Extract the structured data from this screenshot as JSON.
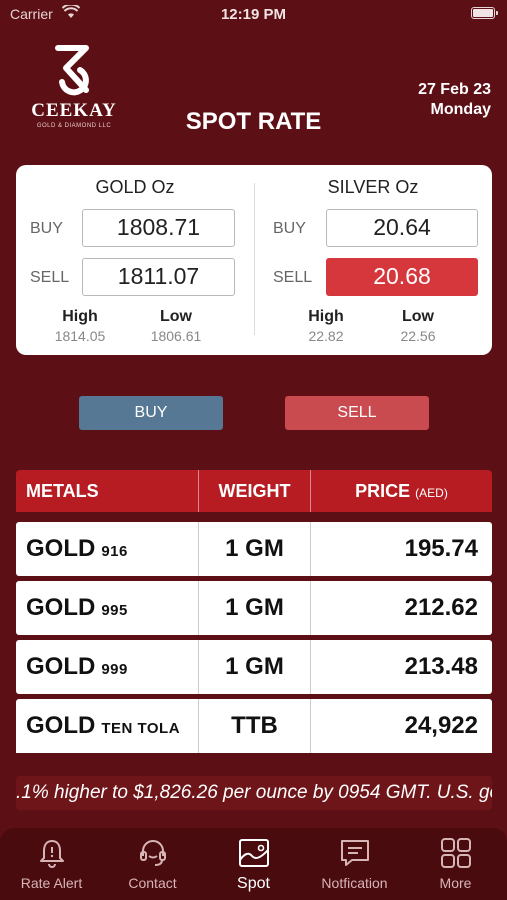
{
  "status_bar": {
    "carrier": "Carrier",
    "time": "12:19 PM"
  },
  "header": {
    "brand": "CEEKAY",
    "brand_sub": "GOLD & DIAMOND LLC",
    "title": "SPOT RATE",
    "date": "27 Feb 23",
    "day": "Monday"
  },
  "rates": {
    "gold": {
      "title": "GOLD Oz",
      "buy_label": "BUY",
      "buy": "1808.71",
      "sell_label": "SELL",
      "sell": "1811.07",
      "high_label": "High",
      "high": "1814.05",
      "low_label": "Low",
      "low": "1806.61"
    },
    "silver": {
      "title": "SILVER Oz",
      "buy_label": "BUY",
      "buy": "20.64",
      "sell_label": "SELL",
      "sell": "20.68",
      "high_label": "High",
      "high": "22.82",
      "low_label": "Low",
      "low": "22.56"
    }
  },
  "actions": {
    "buy": "BUY",
    "sell": "SELL"
  },
  "table": {
    "headers": {
      "metals": "METALS",
      "weight": "WEIGHT",
      "price": "PRICE",
      "price_unit": "(AED)"
    },
    "rows": [
      {
        "metal": "GOLD",
        "purity": "916",
        "weight": "1 GM",
        "price": "195.74"
      },
      {
        "metal": "GOLD",
        "purity": "995",
        "weight": "1 GM",
        "price": "212.62"
      },
      {
        "metal": "GOLD",
        "purity": "999",
        "weight": "1 GM",
        "price": "213.48"
      },
      {
        "metal": "GOLD",
        "purity": "TEN TOLA",
        "weight": "TTB",
        "price": "24,922"
      }
    ]
  },
  "ticker": {
    "text": ".1% higher to $1,826.26 per ounce by 0954 GMT. U.S. gol"
  },
  "tabs": [
    {
      "label": "Rate Alert",
      "icon": "bell-icon"
    },
    {
      "label": "Contact",
      "icon": "headset-icon"
    },
    {
      "label": "Spot",
      "icon": "chart-icon",
      "active": true
    },
    {
      "label": "Notfication",
      "icon": "message-icon"
    },
    {
      "label": "More",
      "icon": "grid-icon"
    }
  ],
  "colors": {
    "background": "#5c0f14",
    "table_header": "#b71c23",
    "buy_button": "#577894",
    "sell_button": "#c94a4f",
    "sell_highlight": "#d6373c"
  }
}
